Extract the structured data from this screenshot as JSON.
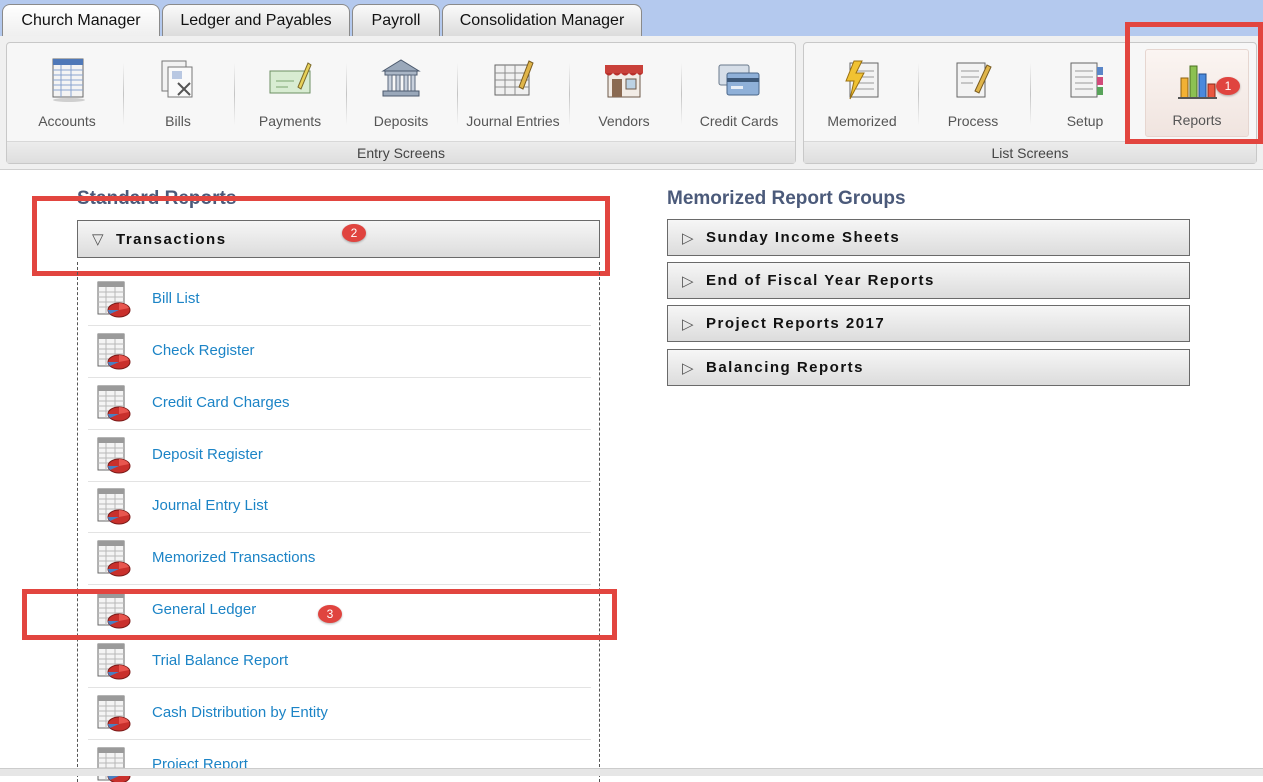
{
  "tabs": [
    {
      "label": "Church Manager"
    },
    {
      "label": "Ledger and Payables"
    },
    {
      "label": "Payroll"
    },
    {
      "label": "Consolidation Manager"
    }
  ],
  "toolbar": {
    "entry_screens": {
      "label": "Entry Screens",
      "items": [
        {
          "label": "Accounts",
          "icon": "accounts-icon"
        },
        {
          "label": "Bills",
          "icon": "bills-icon"
        },
        {
          "label": "Payments",
          "icon": "payments-icon"
        },
        {
          "label": "Deposits",
          "icon": "deposits-icon"
        },
        {
          "label": "Journal Entries",
          "icon": "journal-entries-icon"
        },
        {
          "label": "Vendors",
          "icon": "vendors-icon"
        },
        {
          "label": "Credit Cards",
          "icon": "credit-cards-icon"
        }
      ]
    },
    "list_screens": {
      "label": "List Screens",
      "items": [
        {
          "label": "Memorized",
          "icon": "memorized-icon"
        },
        {
          "label": "Process",
          "icon": "process-icon"
        },
        {
          "label": "Setup",
          "icon": "setup-icon"
        },
        {
          "label": "Reports",
          "icon": "reports-icon"
        }
      ]
    }
  },
  "standard_reports": {
    "title": "Standard Reports",
    "group": {
      "label": "Transactions",
      "expanded": true
    },
    "items": [
      {
        "label": "Bill List"
      },
      {
        "label": "Check Register"
      },
      {
        "label": "Credit Card Charges"
      },
      {
        "label": "Deposit Register"
      },
      {
        "label": "Journal Entry List"
      },
      {
        "label": "Memorized Transactions"
      },
      {
        "label": "General Ledger"
      },
      {
        "label": "Trial Balance Report"
      },
      {
        "label": "Cash Distribution by Entity"
      },
      {
        "label": "Project Report"
      }
    ]
  },
  "memorized_groups": {
    "title": "Memorized Report Groups",
    "items": [
      {
        "label": "Sunday Income Sheets"
      },
      {
        "label": "End of Fiscal Year Reports"
      },
      {
        "label": "Project Reports 2017"
      },
      {
        "label": "Balancing Reports"
      }
    ]
  },
  "annotations": {
    "step1": "1",
    "step2": "2",
    "step3": "3",
    "color": "#e2453f"
  }
}
